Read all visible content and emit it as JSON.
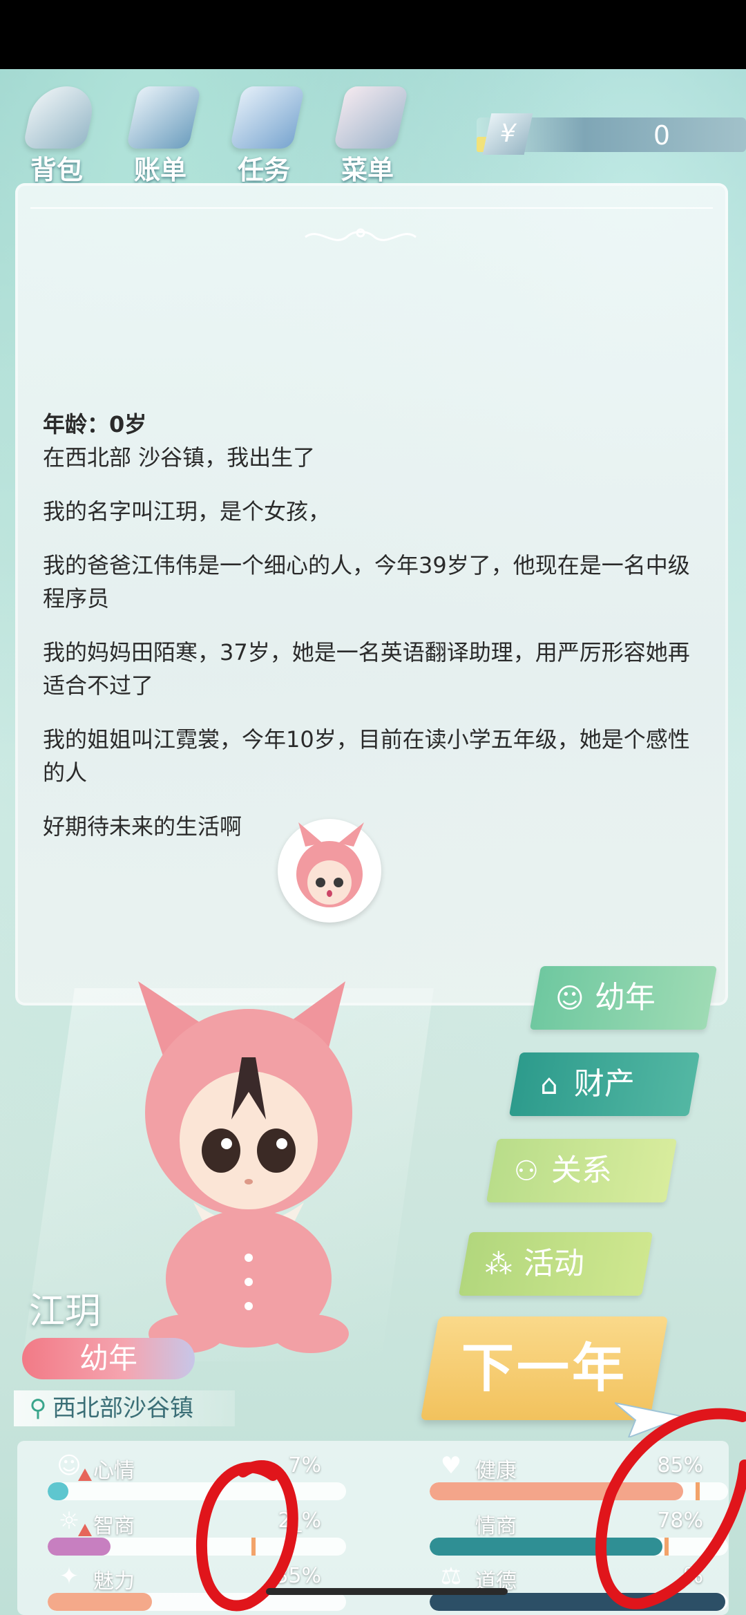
{
  "topbar": {
    "items": [
      {
        "label": "背包",
        "icon": "bag-icon"
      },
      {
        "label": "账单",
        "icon": "bill-icon"
      },
      {
        "label": "任务",
        "icon": "task-icon"
      },
      {
        "label": "菜单",
        "icon": "menu-icon"
      }
    ],
    "money": {
      "symbol": "¥",
      "value": "0"
    }
  },
  "story": {
    "age_line": "年龄：0岁",
    "paragraphs": [
      "在西北部 沙谷镇，我出生了",
      "我的名字叫江玥，是个女孩，",
      "我的爸爸江伟伟是一个细心的人，今年39岁了，他现在是一名中级程序员",
      "我的妈妈田陌寒，37岁，她是一名英语翻译助理，用严厉形容她再适合不过了",
      "我的姐姐叫江霓裳，今年10岁，目前在读小学五年级，她是个感性的人",
      "好期待未来的生活啊"
    ]
  },
  "character": {
    "name": "江玥",
    "stage": "幼年",
    "location": "西北部沙谷镇"
  },
  "side_buttons": [
    {
      "label": "幼年",
      "icon": "baby-icon"
    },
    {
      "label": "财产",
      "icon": "house-icon"
    },
    {
      "label": "关系",
      "icon": "people-icon"
    },
    {
      "label": "活动",
      "icon": "molecule-icon"
    }
  ],
  "next_year": "下一年",
  "stats": [
    {
      "label": "心情",
      "percent": "7%",
      "value": 0.07,
      "color": "#5ec6cf",
      "icon": "smile-icon",
      "warn": true
    },
    {
      "label": "健康",
      "percent": "85%",
      "value": 0.85,
      "color": "#f4a58a",
      "icon": "heart-icon",
      "warn": false
    },
    {
      "label": "智商",
      "percent": "2_%",
      "value": 0.21,
      "color": "#c77fc0",
      "icon": "brain-icon",
      "warn": true
    },
    {
      "label": "情商",
      "percent": "78%",
      "value": 0.78,
      "color": "#2f8f94",
      "icon": "apple-icon",
      "warn": false
    },
    {
      "label": "魅力",
      "percent": "35%",
      "value": 0.35,
      "color": "#f4a98a",
      "icon": "sparkle-icon",
      "warn": false
    },
    {
      "label": "道德",
      "percent": "_%",
      "value": 0.99,
      "color": "#2c4f66",
      "icon": "scale-icon",
      "warn": false
    }
  ]
}
